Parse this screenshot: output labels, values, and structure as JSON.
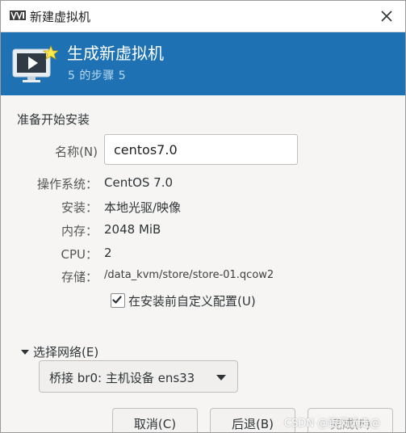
{
  "window": {
    "title": "新建虚拟机",
    "close_icon": "close-icon"
  },
  "banner": {
    "title": "生成新虚拟机",
    "subtitle": "5 的步骤 5",
    "icon": "monitor-play-star-icon",
    "color": "#1e72b3"
  },
  "form": {
    "section_title": "准备开始安装",
    "name_label": "名称(N)",
    "name_value": "centos7.0",
    "rows": [
      {
        "label": "操作系统：",
        "value": "CentOS 7.0"
      },
      {
        "label": "安装：",
        "value": "本地光驱/映像"
      },
      {
        "label": "内存：",
        "value": "2048 MiB"
      },
      {
        "label": "CPU：",
        "value": "2"
      },
      {
        "label": "存储：",
        "value": "/data_kvm/store/store-01.qcow2"
      }
    ],
    "customize_checkbox": {
      "label": "在安装前自定义配置(U)",
      "checked": true
    }
  },
  "network": {
    "expander_label": "选择网络(E)",
    "selected": "桥接 br0: 主机设备 ens33"
  },
  "buttons": {
    "cancel": "取消(C)",
    "back": "后退(B)",
    "finish": "完成(F)"
  },
  "watermark": "CSDN @跟风远走@"
}
